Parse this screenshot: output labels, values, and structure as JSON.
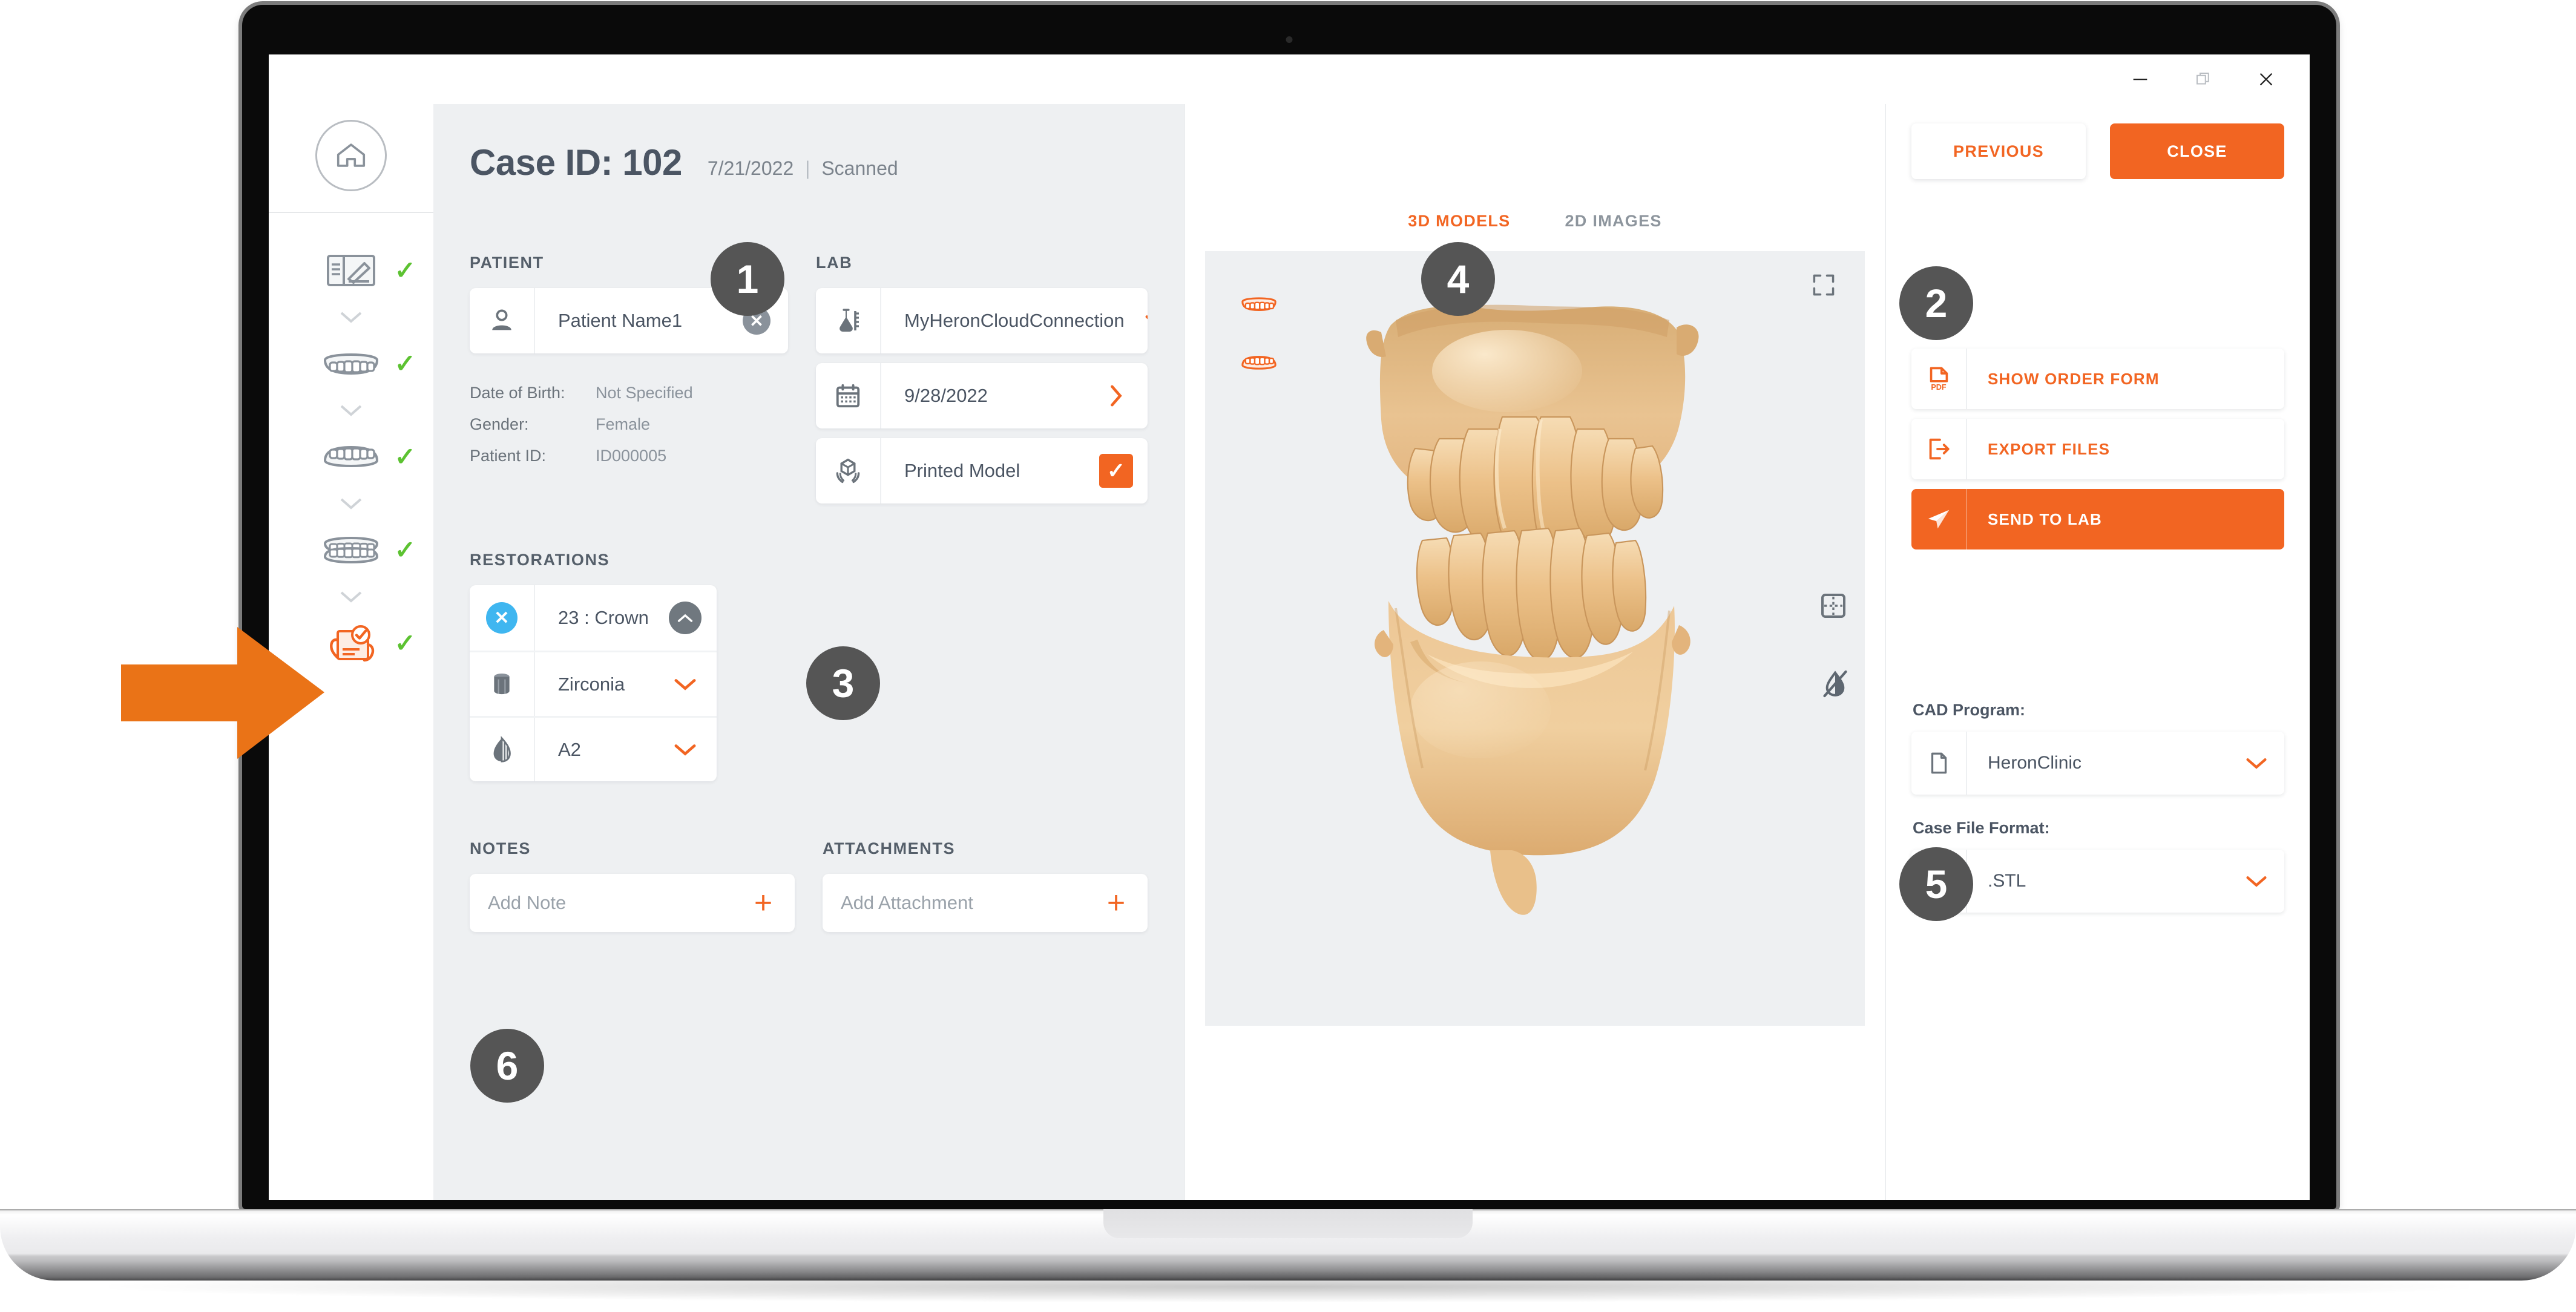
{
  "window": {
    "controls": [
      {
        "name": "minimize",
        "glyph": "—"
      },
      {
        "name": "maximize",
        "glyph": "❐"
      },
      {
        "name": "close",
        "glyph": "✕"
      }
    ]
  },
  "sidebar": {
    "home_label": "Home",
    "steps": [
      {
        "name": "order-form",
        "icon": "order-form-icon",
        "status": "✓",
        "active": false
      },
      {
        "name": "upper-arch",
        "icon": "upper-arch-icon",
        "status": "✓",
        "active": false
      },
      {
        "name": "lower-arch",
        "icon": "lower-arch-icon",
        "status": "✓",
        "active": false
      },
      {
        "name": "bite",
        "icon": "bite-icon",
        "status": "✓",
        "active": false
      },
      {
        "name": "send-case",
        "icon": "send-case-icon",
        "status": "✓",
        "active": true
      }
    ]
  },
  "case": {
    "title": "Case ID: 102",
    "date": "7/21/2022",
    "separator": "|",
    "status": "Scanned"
  },
  "patient": {
    "section_label": "PATIENT",
    "name_value": "Patient Name1",
    "clear_glyph": "✕",
    "details": [
      {
        "label": "Date of Birth:",
        "value": "Not Specified"
      },
      {
        "label": "Gender:",
        "value": "Female"
      },
      {
        "label": "Patient ID:",
        "value": "ID000005"
      }
    ]
  },
  "lab": {
    "section_label": "LAB",
    "connection": "MyHeronCloudConnection",
    "due_date": "9/28/2022",
    "printed_model": "Printed Model",
    "printed_model_checked": true,
    "chevron_down": "⌄",
    "chevron_right": "›",
    "check_glyph": "✓"
  },
  "restorations": {
    "section_label": "RESTORATIONS",
    "tooth": "23 : Crown",
    "material": "Zirconia",
    "shade": "A2",
    "remove_glyph": "✕",
    "collapse_glyph": "⌃",
    "chevron_down": "⌄"
  },
  "notes": {
    "section_label": "NOTES",
    "placeholder": "Add Note",
    "add_glyph": "+"
  },
  "attachments": {
    "section_label": "ATTACHMENTS",
    "placeholder": "Add Attachment",
    "add_glyph": "+"
  },
  "viewer": {
    "tabs": [
      {
        "label": "3D MODELS",
        "active": true
      },
      {
        "label": "2D IMAGES",
        "active": false
      }
    ],
    "tools": [
      {
        "name": "expand-icon"
      },
      {
        "name": "grid-icon"
      },
      {
        "name": "texture-off-icon"
      }
    ],
    "arch_toggles": [
      {
        "name": "upper-arch-toggle"
      },
      {
        "name": "lower-arch-toggle"
      }
    ]
  },
  "right_panel": {
    "previous_label": "PREVIOUS",
    "close_label": "CLOSE",
    "actions": [
      {
        "label": "SHOW ORDER FORM",
        "icon": "pdf-icon",
        "primary": false
      },
      {
        "label": "EXPORT FILES",
        "icon": "export-icon",
        "primary": false
      },
      {
        "label": "SEND TO LAB",
        "icon": "send-icon",
        "primary": true
      }
    ],
    "cad_program_label": "CAD Program:",
    "cad_program_value": "HeronClinic",
    "case_file_format_label": "Case File Format:",
    "case_file_format_value": ".STL",
    "chevron_down": "⌄"
  },
  "callouts": [
    {
      "id": "1",
      "value": "1"
    },
    {
      "id": "2",
      "value": "2"
    },
    {
      "id": "3",
      "value": "3"
    },
    {
      "id": "4",
      "value": "4"
    },
    {
      "id": "5",
      "value": "5"
    },
    {
      "id": "6",
      "value": "6"
    }
  ],
  "colors": {
    "accent": "#f26522",
    "panel_bg": "#eef0f2",
    "text": "#4b5563",
    "muted": "#8a929b",
    "check_green": "#5cc231",
    "info_blue": "#3fb6f0",
    "badge_gray": "#555555",
    "model_tan": "#e8b878"
  }
}
